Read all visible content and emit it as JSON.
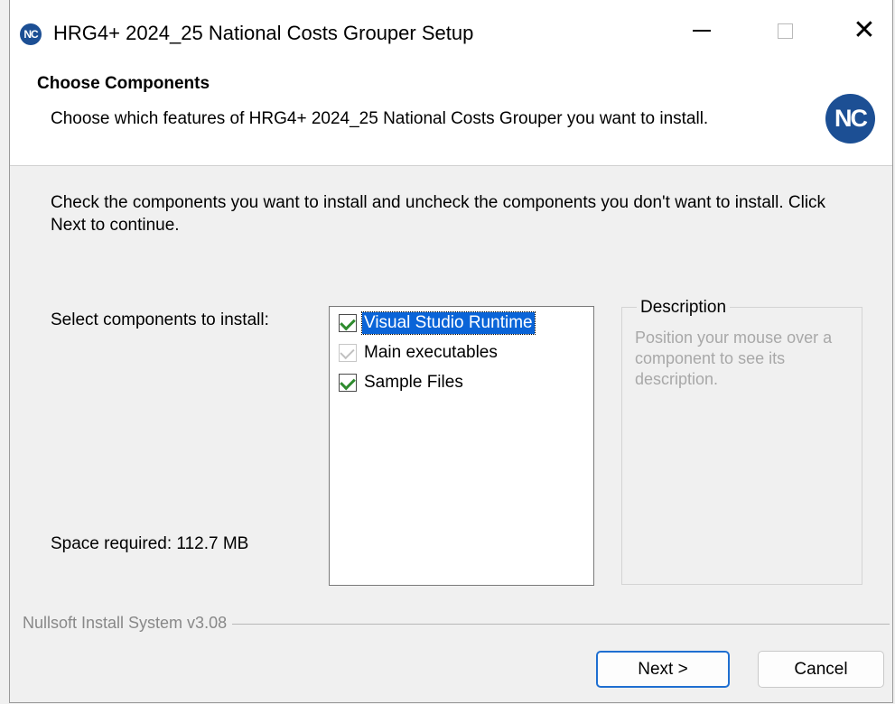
{
  "window": {
    "icon_text": "NC",
    "title": "HRG4+ 2024_25 National Costs Grouper Setup",
    "close_glyph": "✕"
  },
  "header": {
    "title": "Choose Components",
    "subtitle": "Choose which features of HRG4+ 2024_25 National Costs Grouper you want to install.",
    "logo_text": "NC"
  },
  "body": {
    "intro": "Check the components you want to install and uncheck the components you don't want to install. Click Next to continue.",
    "select_label": "Select components to install:",
    "space_required": "Space required: 112.7 MB"
  },
  "components": [
    {
      "label": "Visual Studio Runtime",
      "checked": true,
      "disabled": false,
      "selected": true
    },
    {
      "label": "Main executables",
      "checked": true,
      "disabled": true,
      "selected": false
    },
    {
      "label": "Sample Files",
      "checked": true,
      "disabled": false,
      "selected": false
    }
  ],
  "description": {
    "title": "Description",
    "text": "Position your mouse over a component to see its description."
  },
  "footer": {
    "brand": "Nullsoft Install System v3.08"
  },
  "buttons": {
    "next_label": "Next >",
    "cancel_label": "Cancel"
  },
  "colors": {
    "accent": "#1c4f94",
    "selection": "#0a64d8",
    "check": "#2e8b2e"
  }
}
